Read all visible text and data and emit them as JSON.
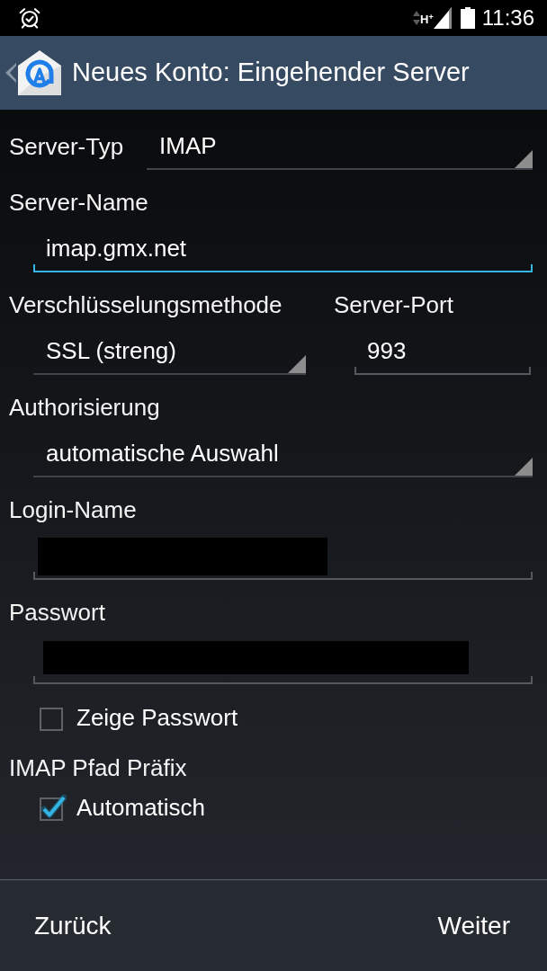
{
  "status_bar": {
    "network_type": "H$^{+}$",
    "time": "11:36"
  },
  "action_bar": {
    "title": "Neues Konto: Eingehender Server"
  },
  "fields": [
    {
      "kind": "inline_select",
      "label": "Server-Typ",
      "value": "IMAP"
    },
    {
      "kind": "text",
      "label": "Server-Name",
      "value": "imap.gmx.net",
      "focused": true,
      "redacted": false
    },
    {
      "kind": "pair",
      "items": [
        {
          "kind": "select",
          "label": "Verschlüsselungsmethode",
          "value": "SSL (streng)"
        },
        {
          "kind": "text",
          "label": "Server-Port",
          "value": "993",
          "focused": false,
          "redacted": false
        }
      ]
    },
    {
      "kind": "select",
      "label": "Authorisierung",
      "value": "automatische Auswahl"
    },
    {
      "kind": "text",
      "label": "Login-Name",
      "focused": false,
      "redacted": true
    },
    {
      "kind": "password",
      "label": "Passwort",
      "focused": false,
      "redacted": true
    },
    {
      "kind": "checkbox",
      "label": "Zeige Passwort",
      "checked": false
    },
    {
      "kind": "heading",
      "label": "IMAP Pfad Präfix"
    },
    {
      "kind": "checkbox",
      "label": "Automatisch",
      "checked": true
    }
  ],
  "buttons": [
    {
      "label": "Zurück"
    },
    {
      "label": "Weiter"
    }
  ]
}
